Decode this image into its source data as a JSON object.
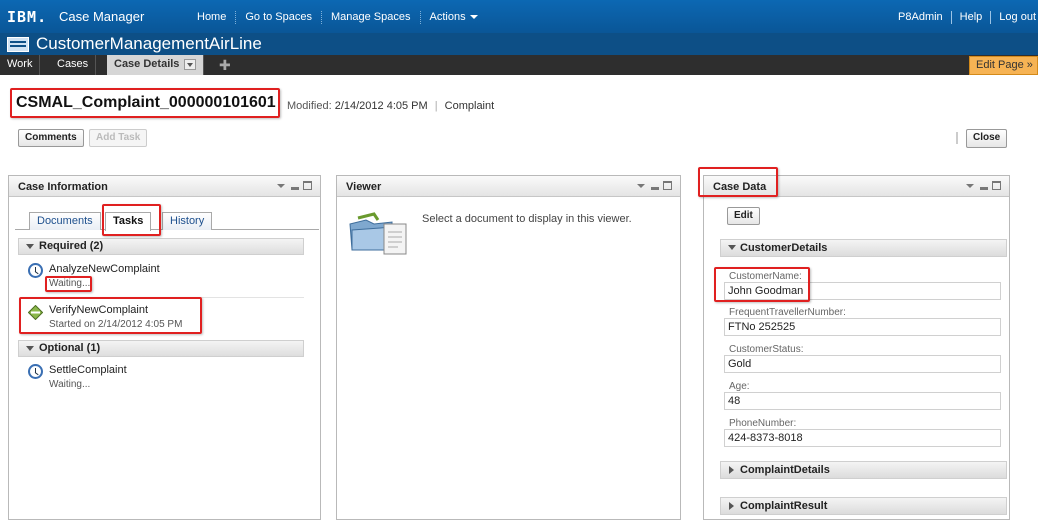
{
  "topbar": {
    "logo": "IBM.",
    "app_name": "Case Manager",
    "nav": [
      "Home",
      "Go to Spaces",
      "Manage Spaces",
      "Actions"
    ],
    "user": "P8Admin",
    "help": "Help",
    "logout": "Log out"
  },
  "solution": {
    "title": "CustomerManagementAirLine"
  },
  "page_tabs": {
    "work": "Work",
    "cases": "Cases",
    "case_details": "Case Details",
    "edit_page": "Edit Page »"
  },
  "case": {
    "title": "CSMAL_Complaint_000000101601",
    "modified_label": "Modified:",
    "modified_value": "2/14/2012 4:05 PM",
    "type": "Complaint",
    "comments_button": "Comments",
    "add_task_button": "Add Task",
    "close_button": "Close"
  },
  "case_info": {
    "title": "Case Information",
    "tabs": {
      "documents": "Documents",
      "tasks": "Tasks",
      "history": "History"
    },
    "required_header": "Required (2)",
    "optional_header": "Optional (1)",
    "tasks": [
      {
        "name": "AnalyzeNewComplaint",
        "status": "Waiting..."
      },
      {
        "name": "VerifyNewComplaint",
        "status": "Started on 2/14/2012 4:05 PM"
      },
      {
        "name": "SettleComplaint",
        "status": "Waiting..."
      }
    ]
  },
  "viewer": {
    "title": "Viewer",
    "message": "Select a document to display in this viewer."
  },
  "case_data": {
    "title": "Case Data",
    "edit_button": "Edit",
    "sections": {
      "customer": "CustomerDetails",
      "complaint": "ComplaintDetails",
      "result": "ComplaintResult"
    },
    "fields": [
      {
        "label": "CustomerName:",
        "value": "John Goodman"
      },
      {
        "label": "FrequentTravellerNumber:",
        "value": "FTNo 252525"
      },
      {
        "label": "CustomerStatus:",
        "value": "Gold"
      },
      {
        "label": "Age:",
        "value": "48"
      },
      {
        "label": "PhoneNumber:",
        "value": "424-8373-8018"
      }
    ]
  }
}
